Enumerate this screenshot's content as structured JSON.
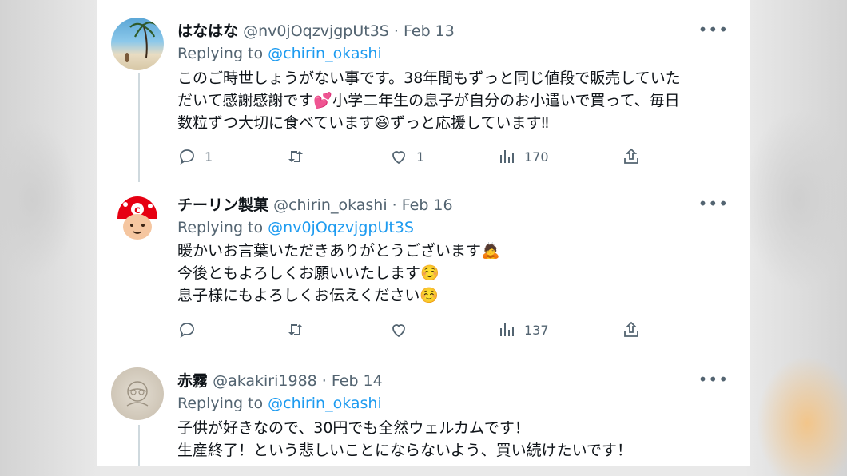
{
  "tweets": [
    {
      "name": "はなはな",
      "handle": "@nv0jOqzvjgpUt3S",
      "date": "· Feb 13",
      "replying_label": "Replying to",
      "replying_to": "@chirin_okashi",
      "lines": [
        "このご時世しょうがない事です。38年間もずっと同じ値段で販売していた",
        "だいて感謝感謝です💕小学二年生の息子が自分のお小遣いで買って、毎日",
        "数粒ずつ大切に食べています😆ずっと応援しています‼"
      ],
      "replies": "1",
      "retweets": "",
      "likes": "1",
      "views": "170"
    },
    {
      "name": "チーリン製菓",
      "handle": "@chirin_okashi",
      "date": "· Feb 16",
      "replying_label": "Replying to",
      "replying_to": "@nv0jOqzvjgpUt3S",
      "lines": [
        "暖かいお言葉いただきありがとうございます🙇",
        "今後ともよろしくお願いいたします☺️",
        "息子様にもよろしくお伝えください☺️"
      ],
      "replies": "",
      "retweets": "",
      "likes": "",
      "views": "137"
    },
    {
      "name": "赤霧",
      "handle": "@akakiri1988",
      "date": "· Feb 14",
      "replying_label": "Replying to",
      "replying_to": "@chirin_okashi",
      "lines": [
        "子供が好きなので、30円でも全然ウェルカムです！",
        "生産終了！という悲しいことにならないよう、買い続けたいです！"
      ]
    }
  ],
  "more_label": "•••",
  "colors": {
    "text": "#0f1419",
    "secondary": "#536471",
    "link": "#1d9bf0",
    "brand_red": "#e60012"
  }
}
